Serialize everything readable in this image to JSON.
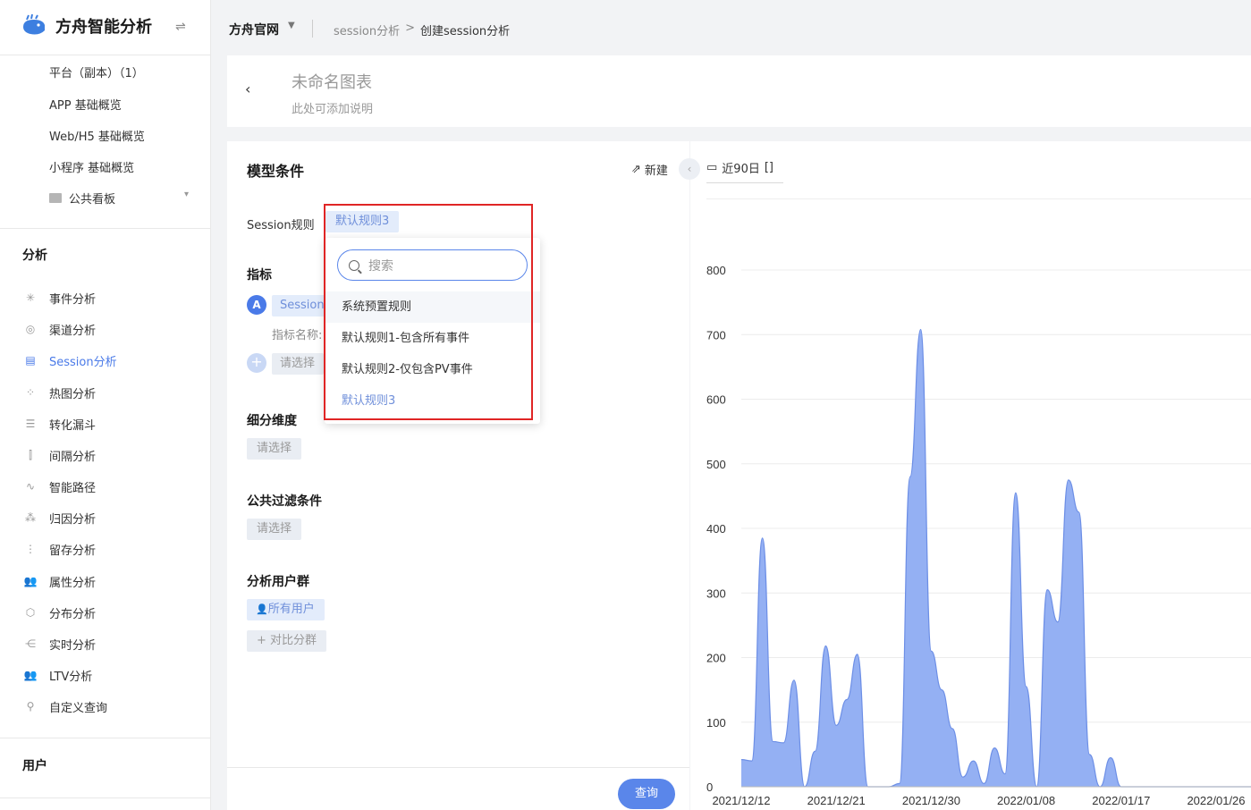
{
  "app": {
    "name": "方舟智能分析"
  },
  "sidebar": {
    "sub_items": [
      "平台（副本）（1）",
      "APP 基础概览",
      "Web/H5 基础概览",
      "小程序 基础概览"
    ],
    "folder": "公共看板",
    "group_analysis": "分析",
    "nav": [
      {
        "label": "事件分析",
        "icon": "burst-icon"
      },
      {
        "label": "渠道分析",
        "icon": "channel-icon"
      },
      {
        "label": "Session分析",
        "icon": "session-icon",
        "active": true
      },
      {
        "label": "热图分析",
        "icon": "heatmap-icon"
      },
      {
        "label": "转化漏斗",
        "icon": "funnel-icon"
      },
      {
        "label": "间隔分析",
        "icon": "interval-icon"
      },
      {
        "label": "智能路径",
        "icon": "path-icon"
      },
      {
        "label": "归因分析",
        "icon": "attribution-icon"
      },
      {
        "label": "留存分析",
        "icon": "retention-icon"
      },
      {
        "label": "属性分析",
        "icon": "users-icon"
      },
      {
        "label": "分布分析",
        "icon": "distribution-icon"
      },
      {
        "label": "实时分析",
        "icon": "realtime-icon"
      },
      {
        "label": "LTV分析",
        "icon": "ltv-icon"
      },
      {
        "label": "自定义查询",
        "icon": "search-icon"
      }
    ],
    "group_users": "用户"
  },
  "breadcrumb": {
    "site": "方舟官网",
    "items": [
      "session分析",
      ">",
      "创建session分析"
    ]
  },
  "chart_header": {
    "title": "未命名图表",
    "desc": "此处可添加说明"
  },
  "model": {
    "title": "模型条件",
    "new_label": "新建",
    "session_rule_label": "Session规则",
    "session_rule_value": "默认规则3",
    "metric_section": "指标",
    "metric_badge": "A",
    "metric_value": "Session",
    "metric_name_label": "指标名称:",
    "select_placeholder": "请选择",
    "breakdown_section": "细分维度",
    "filter_section": "公共过滤条件",
    "group_section": "分析用户群",
    "all_users": "所有用户",
    "compare_group": "+ 对比分群",
    "query": "查询"
  },
  "dropdown": {
    "search_placeholder": "搜索",
    "options": [
      "系统预置规则",
      "默认规则1-包含所有事件",
      "默认规则2-仅包含PV事件",
      "默认规则3"
    ]
  },
  "date_range": {
    "label": "近90日"
  },
  "colors": {
    "accent": "#4a7ae8",
    "area_fill": "#94b0f3",
    "area_line": "#6d8fe6",
    "highlight": "#e02525"
  },
  "chart_data": {
    "type": "area",
    "ylim": [
      0,
      800
    ],
    "y_ticks": [
      0,
      100,
      200,
      300,
      400,
      500,
      600,
      700,
      800
    ],
    "x_tick_labels": [
      "2021/12/12",
      "2021/12/21",
      "2021/12/30",
      "2022/01/08",
      "2022/01/17",
      "2022/01/26"
    ],
    "series": [
      {
        "x": [
          "2021/12/12",
          "2021/12/13",
          "2021/12/14",
          "2021/12/15",
          "2021/12/16",
          "2021/12/17",
          "2021/12/18",
          "2021/12/19",
          "2021/12/20",
          "2021/12/21",
          "2021/12/22",
          "2021/12/23",
          "2021/12/24",
          "2021/12/25",
          "2021/12/26",
          "2021/12/27",
          "2021/12/28",
          "2021/12/29",
          "2021/12/30",
          "2021/12/31",
          "2022/01/01",
          "2022/01/02",
          "2022/01/03",
          "2022/01/04",
          "2022/01/05",
          "2022/01/06",
          "2022/01/07",
          "2022/01/08",
          "2022/01/09",
          "2022/01/10",
          "2022/01/11",
          "2022/01/12",
          "2022/01/13",
          "2022/01/14",
          "2022/01/15",
          "2022/01/16",
          "2022/01/17",
          "2022/01/18",
          "2022/01/19",
          "2022/01/20",
          "2022/01/21",
          "2022/01/22",
          "2022/01/23",
          "2022/01/24",
          "2022/01/25",
          "2022/01/26",
          "2022/01/27",
          "2022/01/28",
          "2022/01/29",
          "2022/01/30"
        ],
        "values": [
          42,
          40,
          385,
          70,
          68,
          165,
          0,
          55,
          218,
          95,
          135,
          205,
          0,
          0,
          0,
          5,
          480,
          708,
          210,
          150,
          90,
          15,
          40,
          5,
          60,
          20,
          455,
          155,
          0,
          305,
          255,
          475,
          425,
          50,
          0,
          45,
          0,
          0,
          0,
          0,
          0,
          0,
          0,
          0,
          0,
          0,
          0,
          0,
          0,
          0
        ]
      }
    ]
  }
}
